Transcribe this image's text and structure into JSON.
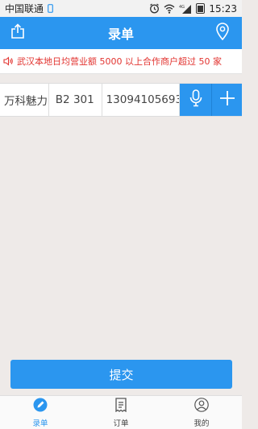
{
  "status_bar": {
    "carrier": "中国联通",
    "network": "4G",
    "time": "15:23"
  },
  "header": {
    "title": "录单",
    "left_icon": "share-icon",
    "right_icon": "location-pin-icon"
  },
  "notice": {
    "icon": "speaker-icon",
    "text": "武汉本地日均营业额 5000 以上合作商户超过 50 家"
  },
  "entry": {
    "name": "万科魅力",
    "address": "B2 301",
    "phone": "13094105693",
    "mic_icon": "microphone-icon",
    "add_icon": "plus-icon"
  },
  "submit": {
    "label": "提交"
  },
  "bottom_nav": {
    "items": [
      {
        "label": "录单",
        "icon": "edit-circle-icon",
        "active": true
      },
      {
        "label": "订单",
        "icon": "receipt-icon",
        "active": false
      },
      {
        "label": "我的",
        "icon": "user-icon",
        "active": false
      }
    ]
  },
  "colors": {
    "accent": "#2b96ef",
    "notice_text": "#e2332f",
    "background": "#eeeae8"
  }
}
